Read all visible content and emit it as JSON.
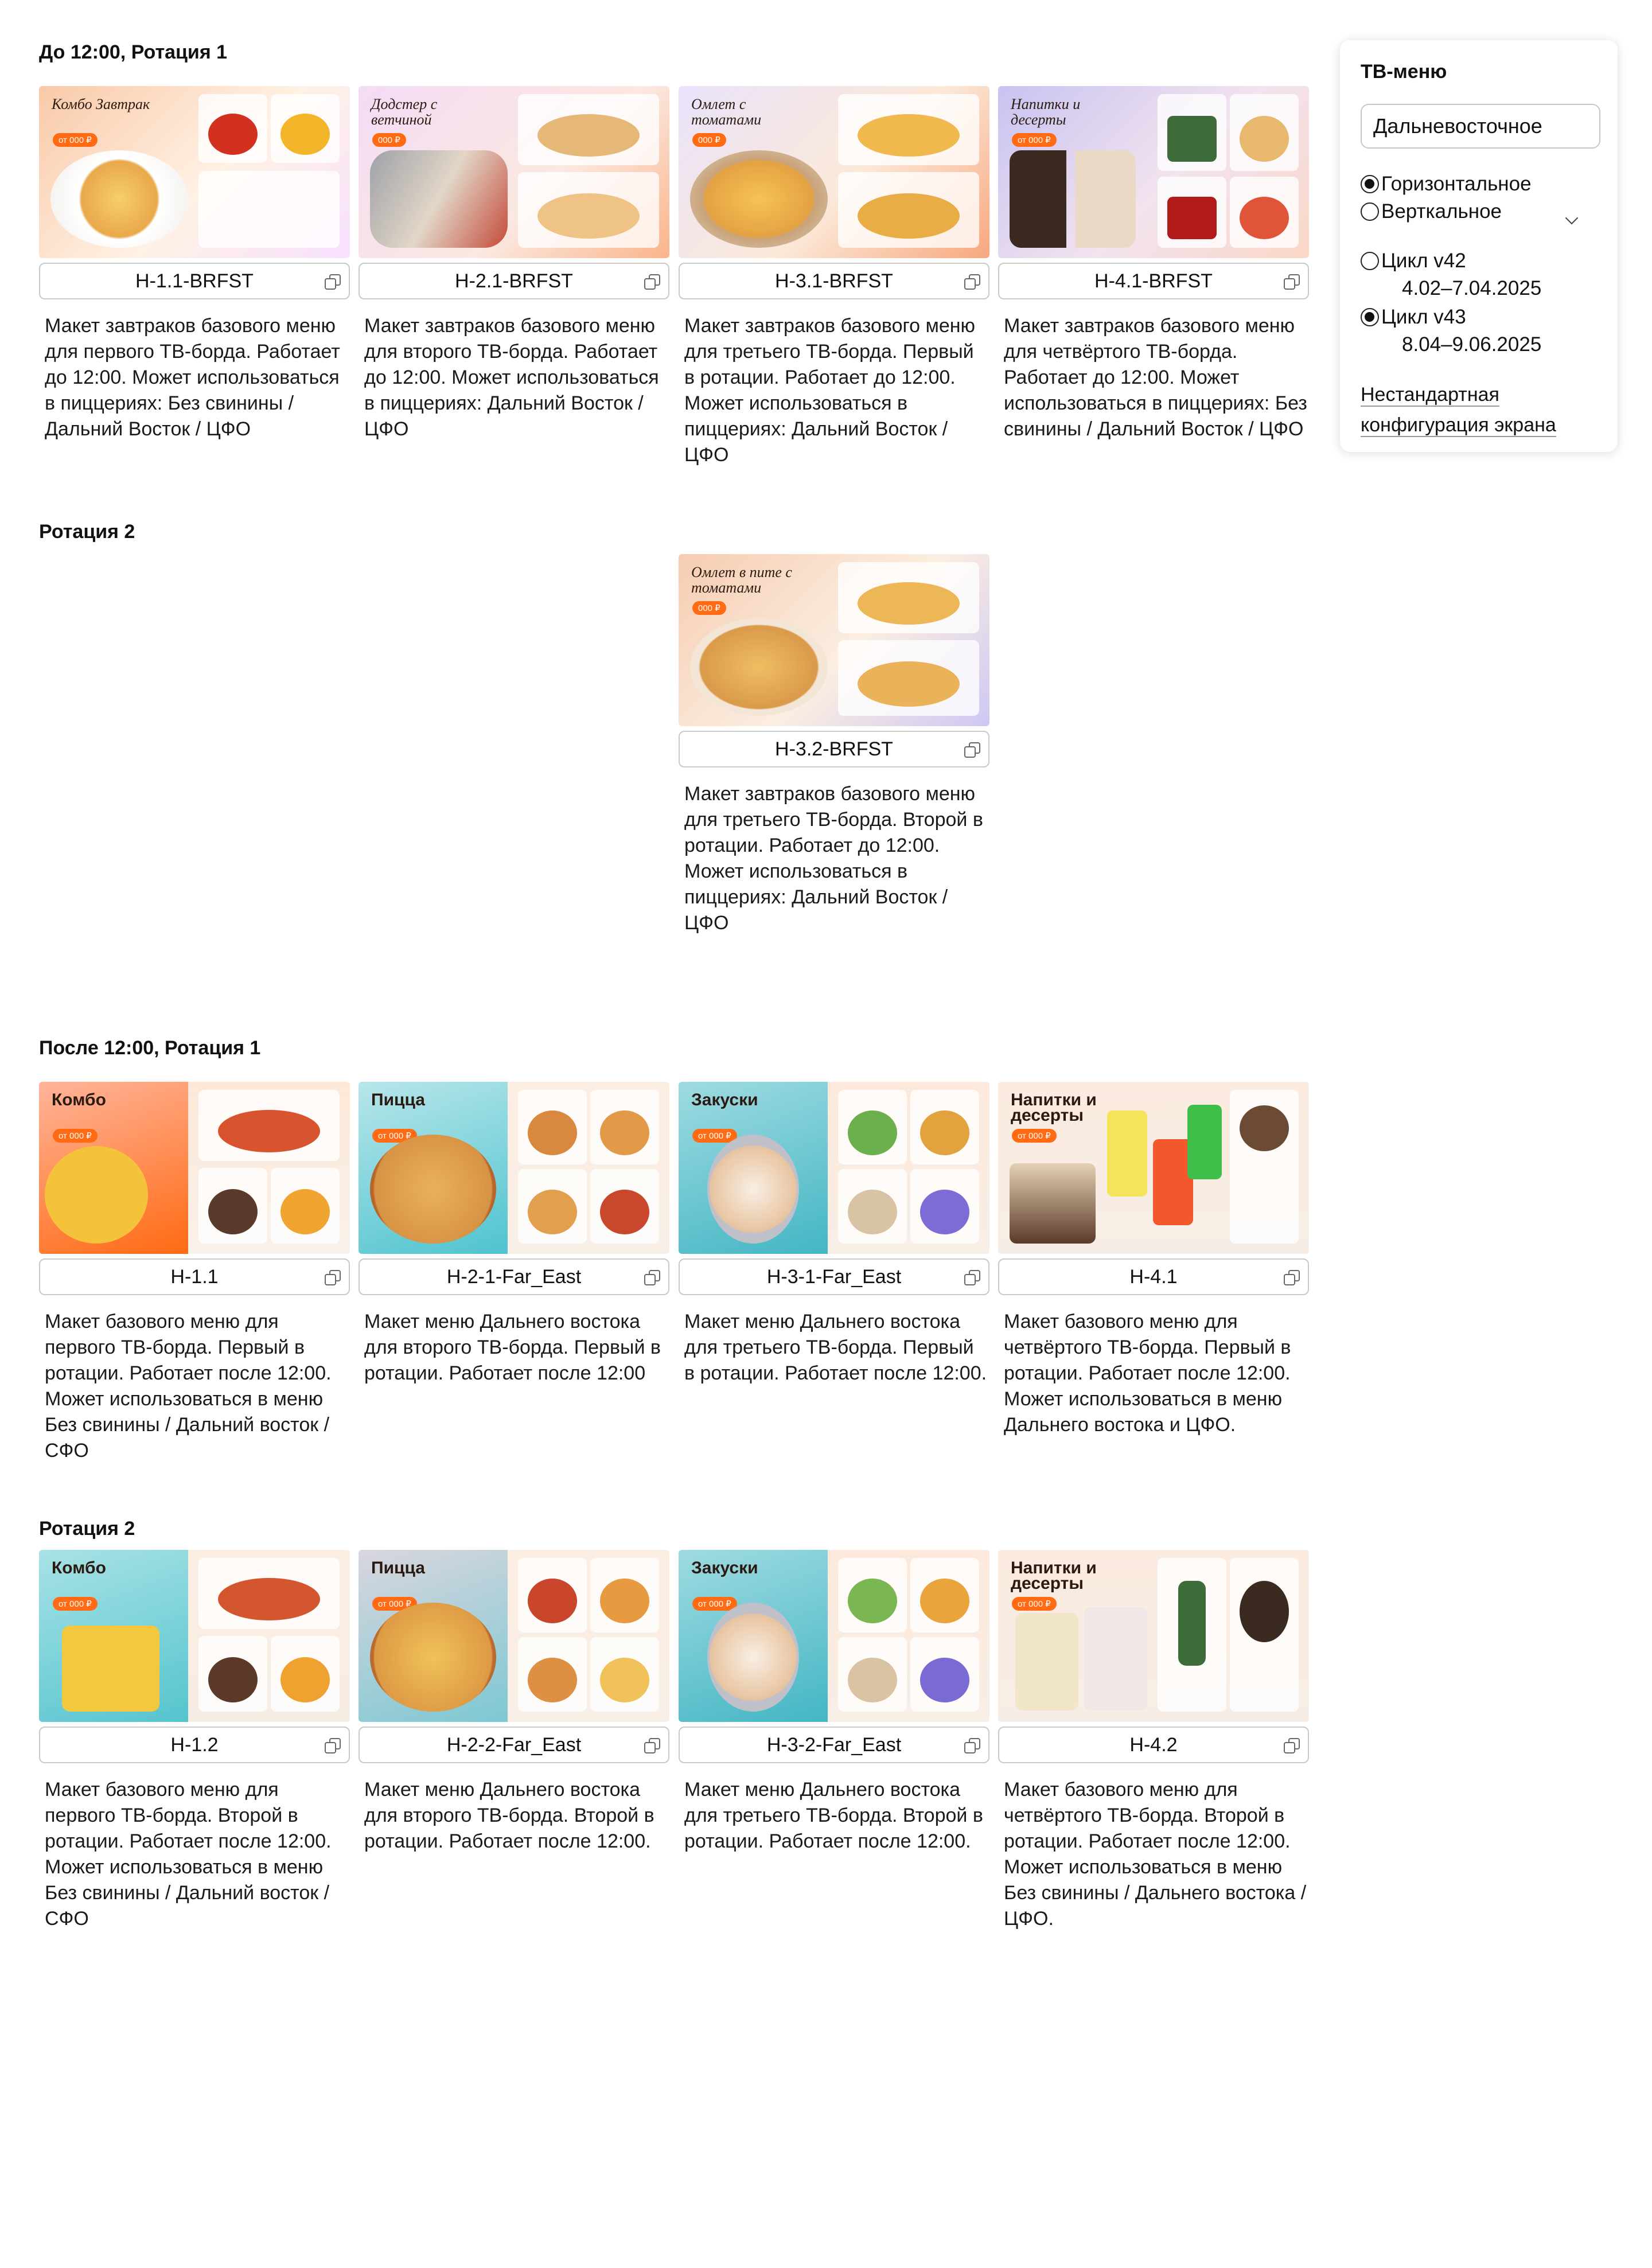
{
  "sections": [
    {
      "title": "До 12:00, Ротация 1"
    },
    {
      "title": "Ротация 2"
    },
    {
      "title": "После 12:00, Ротация 1"
    },
    {
      "title": "Ротация 2"
    }
  ],
  "cards": [
    {
      "code": "H-1.1-BRFST",
      "thumb_title": "Комбо Завтрак",
      "price": "от 000 ₽",
      "desc": "Макет завтраков базового меню для первого ТВ-борда. Работает до 12:00. Может использоваться в пиццериях: Без свинины / Дальний Восток / ЦФО"
    },
    {
      "code": "H-2.1-BRFST",
      "thumb_title": "Додстер с ветчиной",
      "price": "000 ₽",
      "desc": "Макет завтраков базового меню для второго ТВ-борда. Работает до 12:00. Может использоваться в пиццериях: Дальний Восток / ЦФО"
    },
    {
      "code": "H-3.1-BRFST",
      "thumb_title": "Омлет с томатами",
      "price": "000 ₽",
      "desc": "Макет завтраков базового меню для третьего ТВ-борда. Первый в ротации. Работает до 12:00. Может использоваться в пиццериях: Дальний Восток / ЦФО"
    },
    {
      "code": "H-4.1-BRFST",
      "thumb_title": "Напитки и десерты",
      "price": "от 000 ₽",
      "desc": "Макет завтраков базового меню для четвёртого ТВ-борда. Работает до 12:00. Может использоваться в пиццериях: Без свинины / Дальний Восток / ЦФО"
    },
    {
      "code": "H-3.2-BRFST",
      "thumb_title": "Омлет в пите с томатами",
      "price": "000 ₽",
      "desc": "Макет завтраков базового меню для третьего ТВ-борда. Второй в ротации. Работает до 12:00. Может использоваться в пиццериях: Дальний Восток / ЦФО"
    },
    {
      "code": "H-1.1",
      "thumb_title": "Комбо",
      "price": "от 000 ₽",
      "desc": "Макет базового меню для первого ТВ-борда. Первый в ротации. Работает после 12:00. Может использоваться в меню Без свинины / Дальний восток / СФО"
    },
    {
      "code": "H-2-1-Far_East",
      "thumb_title": "Пицца",
      "price": "от 000 ₽",
      "desc": "Макет меню Дальнего востока для второго ТВ-борда. Первый в ротации. Работает после 12:00"
    },
    {
      "code": "H-3-1-Far_East",
      "thumb_title": "Закуски",
      "price": "от 000 ₽",
      "desc": "Макет меню Дальнего востока для третьего ТВ-борда. Первый в ротации. Работает после 12:00."
    },
    {
      "code": "H-4.1",
      "thumb_title": "Напитки и десерты",
      "price": "от 000 ₽",
      "desc": "Макет базового меню для четвёртого ТВ-борда. Первый в ротации. Работает после 12:00. Может использоваться в меню Дальнего востока и ЦФО."
    },
    {
      "code": "H-1.2",
      "thumb_title": "Комбо",
      "price": "от 000 ₽",
      "desc": "Макет базового меню для первого ТВ-борда. Второй в ротации. Работает после 12:00. Может использоваться в меню Без свинины / Дальний восток / СФО"
    },
    {
      "code": "H-2-2-Far_East",
      "thumb_title": "Пицца",
      "price": "от 000 ₽",
      "desc": "Макет меню Дальнего востока для второго ТВ-борда. Второй в ротации. Работает после 12:00."
    },
    {
      "code": "H-3-2-Far_East",
      "thumb_title": "Закуски",
      "price": "от 000 ₽",
      "desc": "Макет меню Дальнего востока для третьего ТВ-борда. Второй в ротации. Работает после 12:00."
    },
    {
      "code": "H-4.2",
      "thumb_title": "Напитки и десерты",
      "price": "от 000 ₽",
      "desc": "Макет базового меню для четвёртого ТВ-борда. Второй в ротации. Работает после 12:00. Может использоваться в меню Без свинины / Дальнего востока / ЦФО."
    }
  ],
  "panel": {
    "title": "ТВ-меню",
    "select_value": "Дальневосточное",
    "orientation": [
      {
        "label": "Горизонтальное",
        "checked": true
      },
      {
        "label": "Верткальное",
        "checked": false
      }
    ],
    "cycles": [
      {
        "name": "Цикл v42",
        "dates": "4.02–7.04.2025",
        "checked": false
      },
      {
        "name": "Цикл v43",
        "dates": "8.04–9.06.2025",
        "checked": true
      }
    ],
    "link": "Нестандартная конфигурация экрана"
  },
  "colors": {
    "brand_orange": "#ff6a13",
    "breakfast_bg": "#fbe6d4",
    "lunch_bg": "#f6eee4",
    "teal": "#4fc3cf",
    "lavender": "#c8c3f0"
  }
}
